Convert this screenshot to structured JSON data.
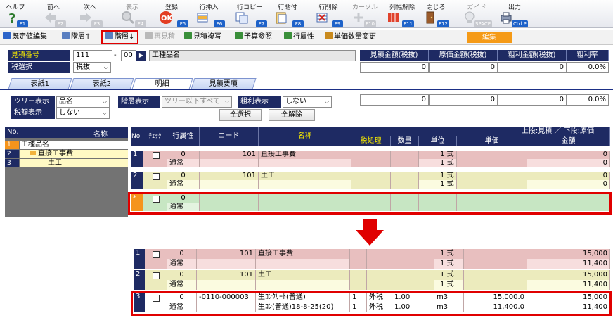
{
  "toolbar": {
    "keys": [
      {
        "label": "ヘルプ",
        "key": "F1",
        "icon": "help-icon",
        "enabled": true
      },
      {
        "label": "前へ",
        "key": "F2",
        "icon": "back-arrow-icon",
        "enabled": false
      },
      {
        "label": "次へ",
        "key": "F3",
        "icon": "forward-arrow-icon",
        "enabled": false
      },
      {
        "label": "表示",
        "key": "F4",
        "icon": "magnifier-icon",
        "enabled": false
      },
      {
        "label": "登録",
        "key": "F5",
        "icon": "register-icon",
        "enabled": true
      },
      {
        "label": "行挿入",
        "key": "F6",
        "icon": "insert-row-icon",
        "enabled": true
      },
      {
        "label": "行コピー",
        "key": "F7",
        "icon": "copy-row-icon",
        "enabled": true
      },
      {
        "label": "行貼付",
        "key": "F8",
        "icon": "paste-row-icon",
        "enabled": true
      },
      {
        "label": "行削除",
        "key": "F9",
        "icon": "delete-row-icon",
        "enabled": true
      },
      {
        "label": "カーソル",
        "key": "F10",
        "icon": "cursor-icon",
        "enabled": false
      },
      {
        "label": "列幅解除",
        "key": "F11",
        "icon": "column-width-icon",
        "enabled": true
      },
      {
        "label": "閉じる",
        "key": "F12",
        "icon": "close-door-icon",
        "enabled": true
      },
      {
        "label": "ガイド",
        "key": "SPACE",
        "icon": "guide-bulb-icon",
        "enabled": false
      },
      {
        "label": "出力",
        "key": "Ctrl P",
        "icon": "print-icon",
        "enabled": true
      }
    ]
  },
  "buttonbar": {
    "items": [
      {
        "label": "既定値編集",
        "enabled": true,
        "color": "#2b63c9"
      },
      {
        "label": "階層↑",
        "enabled": true,
        "color": "#5a7fc0"
      },
      {
        "label": "階層↓",
        "enabled": true,
        "color": "#5a7fc0"
      },
      {
        "label": "再見積",
        "enabled": false,
        "color": "#b9b9b9"
      },
      {
        "label": "見積複写",
        "enabled": true,
        "color": "#3a8f3a"
      },
      {
        "label": "予算参照",
        "enabled": true,
        "color": "#3a8f3a"
      },
      {
        "label": "行属性",
        "enabled": true,
        "color": "#3a8f3a"
      },
      {
        "label": "単価数量変更",
        "enabled": true,
        "color": "#c98a1d"
      }
    ],
    "edit_badge": "編集"
  },
  "header": {
    "estimate_no_label": "見積番号",
    "estimate_no": "111",
    "dash": "-",
    "branch_no": "00",
    "next_btn": "▶",
    "project_name": "工種品名",
    "tax_label": "税選択",
    "tax_value": "税抜"
  },
  "summary": {
    "headers": [
      "見積金額(税抜)",
      "原価金額(税抜)",
      "粗利金額(税抜)",
      "粗利率"
    ],
    "values": [
      "0",
      "0",
      "0",
      "0.0%"
    ],
    "values2": [
      "0",
      "0",
      "0",
      "0.0%"
    ]
  },
  "tabs": [
    "表紙1",
    "表紙2",
    "明細",
    "見積要項"
  ],
  "filters": {
    "tree_label": "ツリー表示",
    "tree_value": "品名",
    "tax_amount_label": "税額表示",
    "tax_amount_value": "しない",
    "level_label": "階層表示",
    "level_value": "ツリー以下すべて",
    "profit_label": "粗利表示",
    "profit_value": "しない",
    "select_all": "全選択",
    "deselect_all": "全解除"
  },
  "tree": {
    "header_no": "No.",
    "header_name": "名称",
    "rows": [
      {
        "no": "1",
        "name": "工種品名"
      },
      {
        "no": "2",
        "name": "直接工事費"
      },
      {
        "no": "3",
        "name": "土工"
      }
    ]
  },
  "grid": {
    "headers": {
      "no": "No.",
      "check": "ﾁｪｯｸ",
      "row_attr": "行属性",
      "code": "コード",
      "name": "名称",
      "upper": "上段:見積 ／ 下段:原価",
      "tax": "税処理",
      "qty": "数量",
      "unit": "単位",
      "price": "単価",
      "amount": "金額"
    },
    "before_rows": [
      {
        "no": "1",
        "attr": "0",
        "attr2": "通常",
        "code": "101",
        "name": "直接工事費",
        "qty": "1",
        "unit": "式",
        "qty2": "1",
        "unit2": "式",
        "amount": "0",
        "amount2": "0"
      },
      {
        "no": "2",
        "attr": "0",
        "attr2": "通常",
        "code": "101",
        "name": "土工",
        "qty": "1",
        "unit": "式",
        "qty2": "1",
        "unit2": "式",
        "amount": "0",
        "amount2": "0"
      },
      {
        "no": "*",
        "attr": "0",
        "attr2": "通常"
      }
    ],
    "after_rows": [
      {
        "no": "1",
        "attr": "0",
        "attr2": "通常",
        "code": "101",
        "name": "直接工事費",
        "qty": "1",
        "unit": "式",
        "qty2": "1",
        "unit2": "式",
        "amount": "15,000",
        "amount2": "11,400"
      },
      {
        "no": "2",
        "attr": "0",
        "attr2": "通常",
        "code": "101",
        "name": "土工",
        "qty": "1",
        "unit": "式",
        "qty2": "1",
        "unit2": "式",
        "amount": "15,000",
        "amount2": "11,400"
      },
      {
        "no": "3",
        "attr": "0",
        "attr2": "通常",
        "code": "-0110-000003",
        "name": "生ｺﾝｸﾘｰﾄ(普通)",
        "name2": "生ｺﾝ(普通)18-8-25(20)",
        "flag": "1",
        "flag2": "1",
        "tax": "外税",
        "tax2": "外税",
        "qty": "1.00",
        "qty2": "1.00",
        "unit": "m3",
        "unit2": "m3",
        "price": "15,000.0",
        "price2": "11,400.0",
        "amount": "15,000",
        "amount2": "11,400"
      }
    ]
  }
}
